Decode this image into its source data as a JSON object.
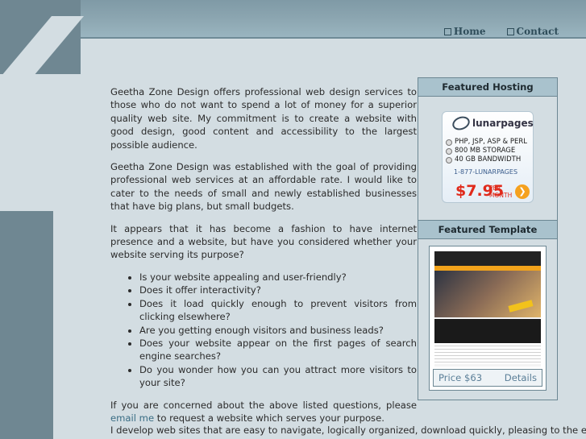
{
  "nav": {
    "home": "Home",
    "contact": "Contact"
  },
  "content": {
    "p1": "Geetha Zone Design offers professional web design services to those who do not want to spend a lot of money for a superior quality web site. My commitment is to create a website with good design, good content and accessibility to the largest possible audience.",
    "p2": "Geetha Zone Design was established with the goal of providing professional web services at an affordable rate. I would like to cater to the needs of small and newly established businesses that have big plans, but small budgets.",
    "p3": "It appears that it has become a fashion to have internet presence and a website,  but have you considered whether your website serving its purpose?",
    "bullets": [
      "Is your website appealing and user-friendly?",
      "Does it offer interactivity?",
      "Does it load quickly enough to prevent visitors from clicking elsewhere?",
      "Are you getting enough visitors and business leads?",
      "Does your website appear on the first pages of search engine searches?",
      "Do you wonder how you can you attract more visitors to your site?"
    ],
    "p4_before": "If you are concerned about the above listed questions, please ",
    "p4_link": "email me",
    "p4_after": " to request a website which serves your purpose.",
    "p5": "I develop web sites that are easy to navigate, logically organized, download quickly, pleasing to the eye,"
  },
  "sidebar": {
    "hosting_title": "Featured Hosting",
    "ad": {
      "brand": "lunarpages",
      "features": [
        "PHP, JSP, ASP & PERL",
        "800 MB STORAGE",
        "40 GB BANDWIDTH"
      ],
      "phone": "1-877-LUNARPAGES",
      "price": "$7.95",
      "per": "PER",
      "month": "MONTH"
    },
    "template_title": "Featured Template",
    "template_price": "Price $63",
    "template_details": "Details"
  }
}
